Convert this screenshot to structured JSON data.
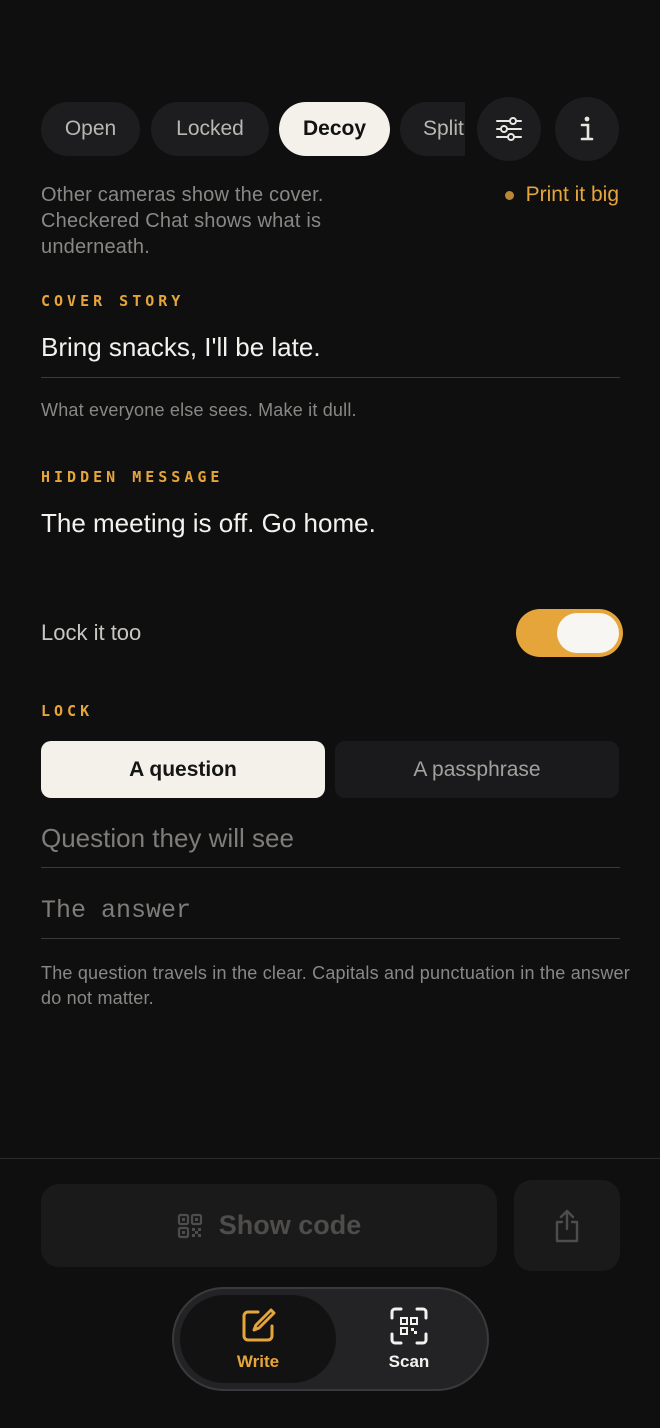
{
  "modes": {
    "tabs": [
      "Open",
      "Locked",
      "Decoy",
      "Split"
    ],
    "active": "Decoy",
    "description": "Other cameras show the cover. Checkered Chat shows what is underneath.",
    "print_big": "Print it big"
  },
  "icons": {
    "settings": "sliders-icon",
    "info": "info-icon",
    "qr": "qr-code-icon",
    "share": "share-icon",
    "write": "edit-icon",
    "scan": "qr-scan-icon"
  },
  "cover_story": {
    "label": "COVER STORY",
    "value": "Bring snacks, I'll be late.",
    "hint": "What everyone else sees. Make it dull."
  },
  "hidden_message": {
    "label": "HIDDEN MESSAGE",
    "value": "The meeting is off. Go home."
  },
  "lock_toggle": {
    "label": "Lock it too",
    "on": true
  },
  "lock": {
    "label": "LOCK",
    "options": [
      "A question",
      "A passphrase"
    ],
    "selected": "A question",
    "question_placeholder": "Question they will see",
    "answer_placeholder": "The answer",
    "hint": "The question travels in the clear. Capitals and punctuation in the answer do not matter."
  },
  "actions": {
    "show_code": "Show code"
  },
  "tabbar": {
    "write": "Write",
    "scan": "Scan",
    "active": "Write"
  },
  "colors": {
    "accent": "#e6a53b",
    "background": "#0f0f10"
  }
}
